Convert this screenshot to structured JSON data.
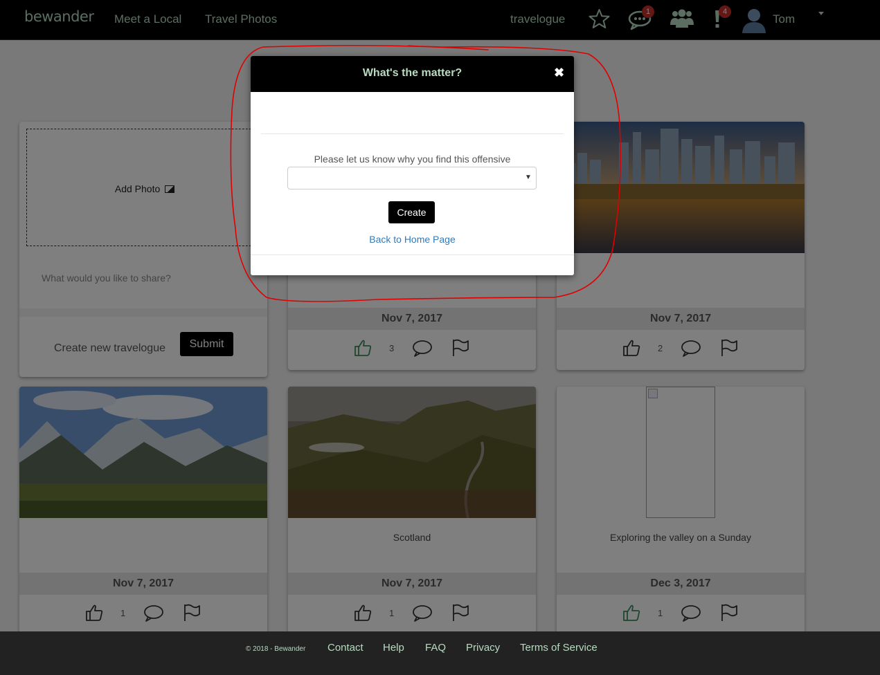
{
  "navbar": {
    "brand": "bewander",
    "links": [
      "Meet a Local",
      "Travel Photos"
    ],
    "travelogue": "travelogue",
    "messages_badge": "1",
    "alerts_badge": "4",
    "username": "Tom",
    "icons": [
      "star-icon",
      "chat-icon",
      "friends-icon",
      "alert-icon",
      "user-avatar-icon",
      "caret-down-icon"
    ]
  },
  "new_post": {
    "add_photo_label": "Add Photo",
    "share_placeholder": "What would you like to share?",
    "create_label": "Create new travelogue",
    "submit_label": "Submit"
  },
  "posts": [
    {
      "caption": "",
      "date": "Nov 7, 2017",
      "likes": "3",
      "liked": true
    },
    {
      "caption": "",
      "date": "Nov 7, 2017",
      "likes": "2",
      "liked": false
    },
    {
      "caption": "",
      "date": "Nov 7, 2017",
      "likes": "1",
      "liked": false
    },
    {
      "caption": "Scotland",
      "date": "Nov 7, 2017",
      "likes": "1",
      "liked": false
    },
    {
      "caption": "Exploring the valley on a Sunday",
      "date": "Dec 3, 2017",
      "likes": "1",
      "liked": true
    }
  ],
  "modal": {
    "title": "What's the matter?",
    "close": "✖",
    "reason_label": "Please let us know why you find this offensive",
    "reason_value": "",
    "create_label": "Create",
    "back_link": "Back to Home Page"
  },
  "footer": {
    "copyright": "© 2018 - Bewander",
    "links": [
      "Contact",
      "Help",
      "FAQ",
      "Privacy",
      "Terms of Service"
    ]
  },
  "colors": {
    "brand_green": "#b8dcc2",
    "liked_green": "#3c8c5c",
    "link_blue": "#337ab7",
    "annotation_red": "#e00000"
  }
}
